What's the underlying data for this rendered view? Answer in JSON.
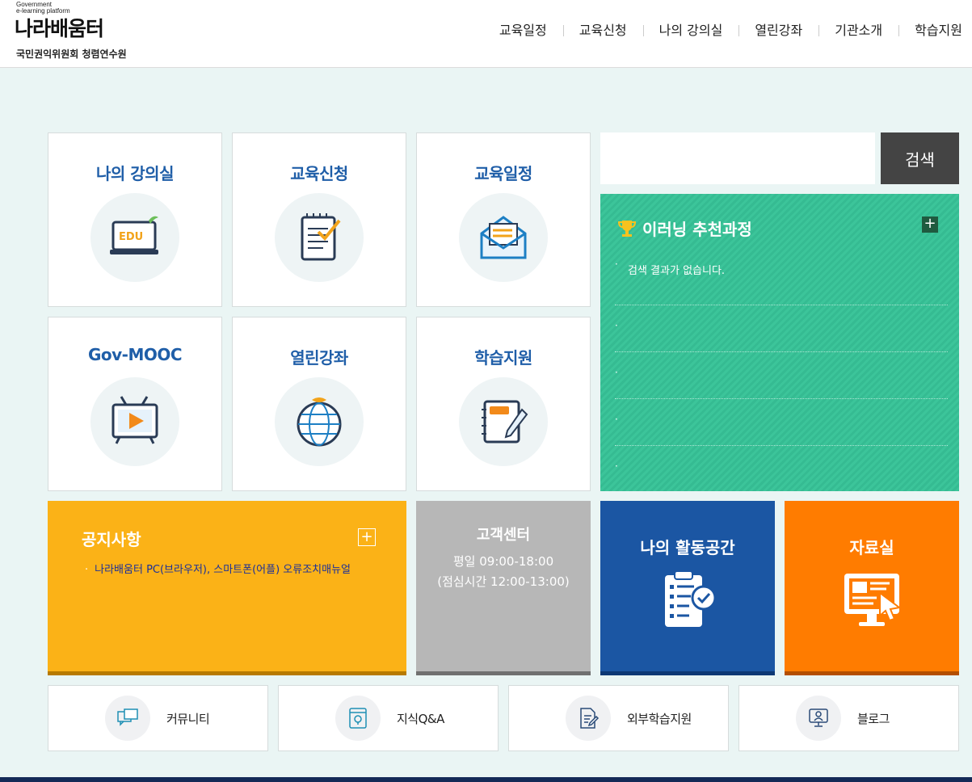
{
  "header": {
    "logo_small": "Government\ne-learning platform",
    "logo_main": "나라배움터",
    "logo_sub": "국민권익위원회 청렴연수원",
    "nav": [
      "교육일정",
      "교육신청",
      "나의 강의실",
      "열린강좌",
      "기관소개",
      "학습지원"
    ]
  },
  "tiles": {
    "my_classroom": "나의 강의실",
    "edu_apply": "교육신청",
    "edu_schedule": "교육일정",
    "gov_mooc": "Gov-MOOC",
    "open_lecture": "열린강좌",
    "study_support": "학습지원",
    "edu_icon_text": "EDU"
  },
  "search": {
    "placeholder": "",
    "button": "검색"
  },
  "recommend": {
    "title": "이러닝 추천과정",
    "plus": "+",
    "items": [
      "검색 결과가 없습니다.",
      "",
      "",
      "",
      ""
    ]
  },
  "notice": {
    "title": "공지사항",
    "plus": "+",
    "item": "나라배움터 PC(브라우저), 스마트폰(어플) 오류조치매뉴얼"
  },
  "customer": {
    "title": "고객센터",
    "hours": "평일 09:00-18:00",
    "lunch": "(점심시간 12:00-13:00)"
  },
  "activity": {
    "title": "나의 활동공간"
  },
  "library": {
    "title": "자료실"
  },
  "bottom_links": [
    "커뮤니티",
    "지식Q&A",
    "외부학습지원",
    "블로그"
  ],
  "colors": {
    "notice": "#fbb217",
    "customer": "#b7b7b7",
    "activity": "#1b56a3",
    "library": "#ff7c00",
    "recommend": "#3cc59a",
    "title_blue": "#1f5ea8"
  }
}
